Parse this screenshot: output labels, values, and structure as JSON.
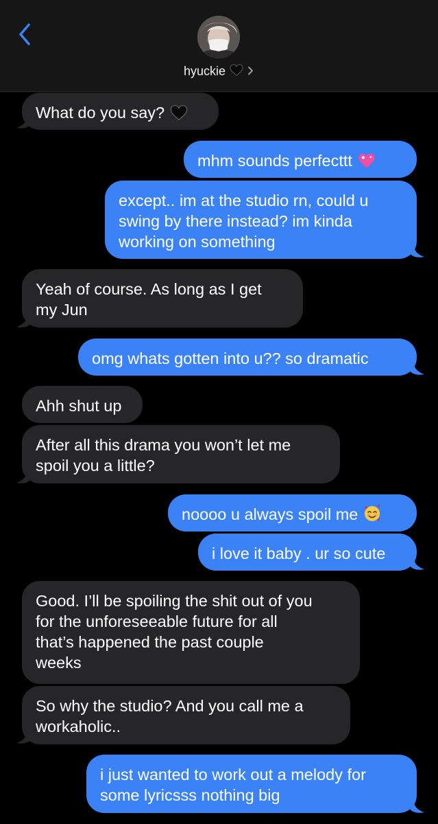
{
  "contact": {
    "name": "hyuckie"
  },
  "colors": {
    "sent": "#3b82f6",
    "received": "#262628",
    "accent": "#3b82f6"
  },
  "messages": [
    {
      "side": "received",
      "text": "What do you say?",
      "emoji": "black-heart"
    },
    {
      "side": "sent",
      "text": "mhm sounds perfecttt",
      "emoji": "sparkling-heart"
    },
    {
      "side": "sent",
      "lines": [
        "except.. im at the studio rn, could u",
        "swing by there instead? im kinda",
        "working on something"
      ]
    },
    {
      "side": "received",
      "lines": [
        "Yeah of course. As long as I get",
        "my Jun"
      ]
    },
    {
      "side": "sent",
      "text": "omg whats gotten into u?? so dramatic"
    },
    {
      "side": "received",
      "text": "Ahh shut up"
    },
    {
      "side": "received",
      "lines": [
        "After all this drama you won’t let me",
        "spoil you a little?"
      ]
    },
    {
      "side": "sent",
      "text": "noooo u always spoil me",
      "emoji": "smiling-face-with-hearts"
    },
    {
      "side": "sent",
      "text": "i love it baby . ur so cute"
    },
    {
      "side": "received",
      "lines": [
        "Good. I’ll be spoiling the shit out of you",
        "for the unforeseeable future for all",
        "that’s happened the past couple",
        "weeks"
      ]
    },
    {
      "side": "received",
      "lines": [
        "So why the studio? And you call me a",
        "workaholic.."
      ]
    },
    {
      "side": "sent",
      "lines": [
        "i just wanted to work out a melody for",
        "some lyricsss nothing big"
      ]
    }
  ]
}
